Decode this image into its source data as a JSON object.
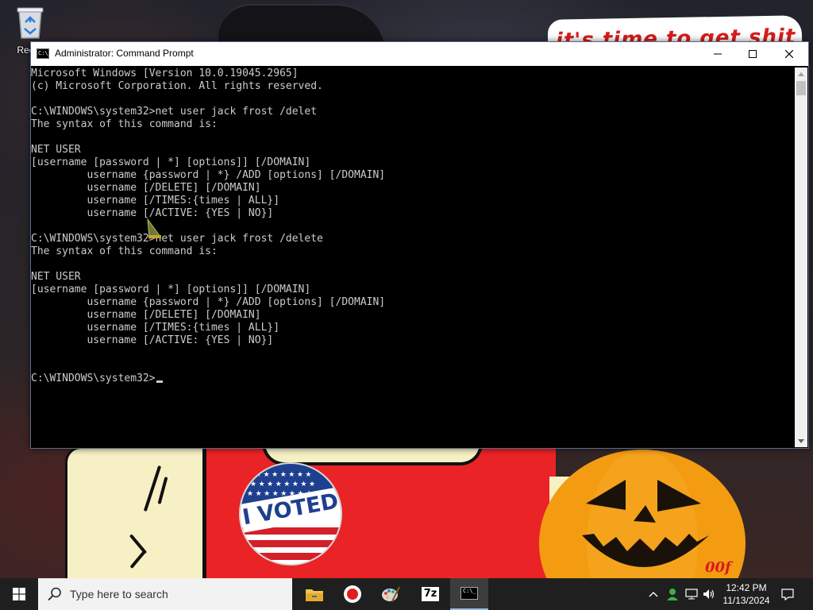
{
  "desktop": {
    "recycle_bin_label": "Recyc",
    "banner_text": "it's time to get shit",
    "sticker_text": "I VOTED",
    "scribble_text": "00f"
  },
  "window": {
    "title": "Administrator: Command Prompt",
    "icon_glyph": "C:\\_"
  },
  "console_lines": [
    "Microsoft Windows [Version 10.0.19045.2965]",
    "(c) Microsoft Corporation. All rights reserved.",
    "",
    "C:\\WINDOWS\\system32>net user jack frost /delet",
    "The syntax of this command is:",
    "",
    "NET USER",
    "[username [password | *] [options]] [/DOMAIN]",
    "         username {password | *} /ADD [options] [/DOMAIN]",
    "         username [/DELETE] [/DOMAIN]",
    "         username [/TIMES:{times | ALL}]",
    "         username [/ACTIVE: {YES | NO}]",
    "",
    "C:\\WINDOWS\\system32>net user jack frost /delete",
    "The syntax of this command is:",
    "",
    "NET USER",
    "[username [password | *] [options]] [/DOMAIN]",
    "         username {password | *} /ADD [options] [/DOMAIN]",
    "         username [/DELETE] [/DOMAIN]",
    "         username [/TIMES:{times | ALL}]",
    "         username [/ACTIVE: {YES | NO}]",
    "",
    "",
    "C:\\WINDOWS\\system32>"
  ],
  "taskbar": {
    "search_placeholder": "Type here to search",
    "apps": [
      {
        "name": "file-explorer-icon"
      },
      {
        "name": "screen-recorder-icon"
      },
      {
        "name": "paint-icon"
      },
      {
        "name": "7zip-icon",
        "glyph": "7z"
      },
      {
        "name": "command-prompt-icon",
        "glyph": "C:\\_",
        "active": true
      }
    ],
    "clock": {
      "time": "12:42 PM",
      "date": "11/13/2024"
    }
  },
  "colors": {
    "console_bg": "#000000",
    "console_fg": "#cccccc",
    "taskbar_bg": "#1f1f1f",
    "banner_red": "#d91b1b"
  }
}
